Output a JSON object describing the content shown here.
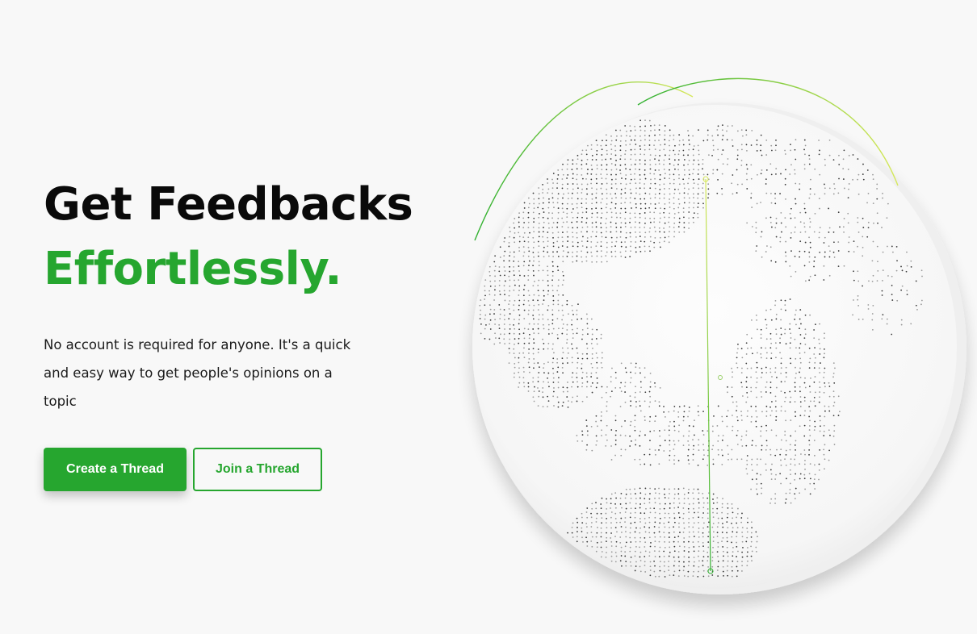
{
  "hero": {
    "title_line1": "Get Feedbacks",
    "title_line2": "Effortlessly.",
    "subtitle": "No account is required for anyone. It's a quick and easy way to get people's opinions on a topic"
  },
  "actions": {
    "create_label": "Create a Thread",
    "join_label": "Join a Thread"
  },
  "colors": {
    "accent": "#26a62f",
    "background": "#f8f8f8",
    "arc_start": "#2fb02f",
    "arc_end": "#d6e85a"
  },
  "globe": {
    "icon": "dotted-world-globe-icon"
  }
}
